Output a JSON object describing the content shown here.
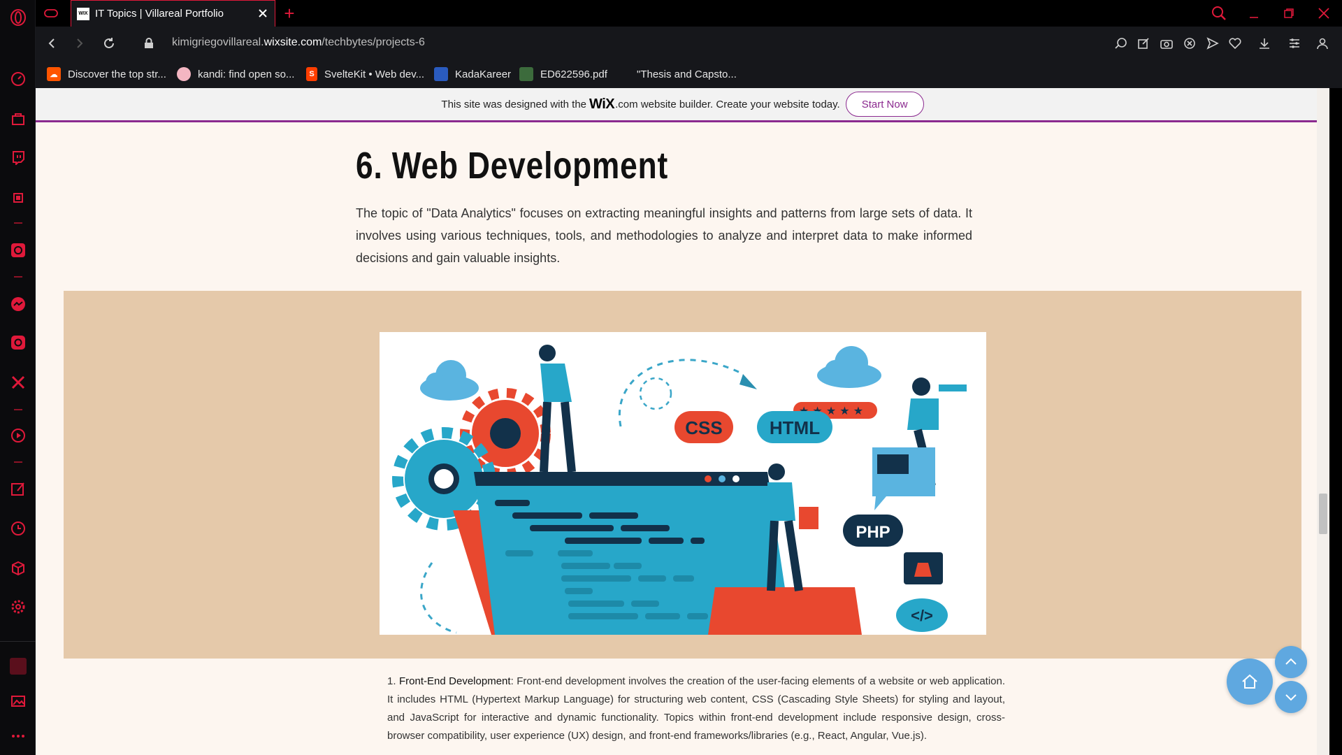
{
  "browser": {
    "tab_title": "IT Topics | Villareal Portfolio",
    "new_tab_symbol": "+",
    "url_prefix": "kimigriegovillareal.",
    "url_domain": "wixsite.com",
    "url_path": "/techbytes/projects-6",
    "favicon_text": "WIX"
  },
  "bookmarks": [
    {
      "label": "Discover the top str...",
      "icon": "soundcloud-icon"
    },
    {
      "label": "kandi: find open so...",
      "icon": "kandi-icon"
    },
    {
      "label": "SvelteKit • Web dev...",
      "icon": "svelte-icon"
    },
    {
      "label": "KadaKareer",
      "icon": "kadakareer-icon"
    },
    {
      "label": "ED622596.pdf",
      "icon": "pdf-icon"
    },
    {
      "label": "\"Thesis and Capsto...",
      "icon": ""
    }
  ],
  "wix_banner": {
    "before": "This site was designed with the",
    "logo": "WiX",
    "after": ".com website builder. Create your website today.",
    "button": "Start Now"
  },
  "section": {
    "title": "6. Web Development",
    "description": "The topic of \"Data Analytics\" focuses on extracting meaningful insights and patterns from large sets of data. It involves using various techniques, tools, and methodologies to analyze and interpret data to make informed decisions and gain valuable insights."
  },
  "illustration": {
    "badges": [
      "CSS",
      "HTML",
      "PHP",
      "</>"
    ]
  },
  "list": {
    "number": "1.",
    "term": "Front-End Development",
    "text": ": Front-end development involves the creation of the user-facing elements of a website or web application. It includes HTML (Hypertext Markup Language) for structuring web content, CSS (Cascading Style Sheets) for styling and layout, and JavaScript for interactive and dynamic functionality. Topics within front-end development include responsive design, cross-browser compatibility, user experience (UX) design, and front-end frameworks/libraries (e.g., React, Angular, Vue.js)."
  },
  "colors": {
    "accent_red": "#e0193a",
    "wix_purple": "#8b2a8f",
    "image_band": "#e5c9aa",
    "fab_blue": "#5fa8e0"
  }
}
